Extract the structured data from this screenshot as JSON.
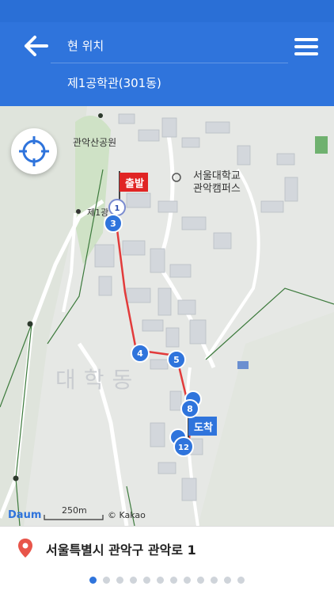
{
  "header": {
    "current_location_label": "현 위치",
    "destination_label": "제1공학관(301동)"
  },
  "map": {
    "park_label": "관악산공원",
    "campus_label_line1": "서울대학교",
    "campus_label_line2": "관악캠퍼스",
    "area_label": "대학동",
    "place_label": "제1광",
    "start_flag": "출발",
    "end_flag": "도착",
    "scale_text": "250m",
    "copyright": "© Kakao",
    "logo": "Daum",
    "stops": [
      "1",
      "3",
      "4",
      "5",
      "8",
      "12"
    ],
    "route_color": "#e23b3b",
    "stop_color": "#2f74dc"
  },
  "address": {
    "text": "서울특별시 관악구 관악로 1"
  },
  "pager": {
    "count": 12,
    "active_index": 0
  },
  "colors": {
    "header_bg": "#2f74dc",
    "accent": "#2f74dc"
  }
}
